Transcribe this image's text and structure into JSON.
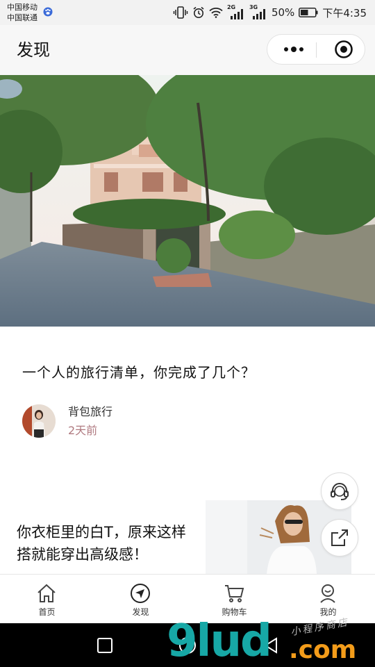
{
  "status_bar": {
    "carrier_1": "中国移动",
    "carrier_2": "中国联通",
    "net_label_1": "2G",
    "net_label_2": "3G",
    "battery": "50%",
    "time": "下午4:35"
  },
  "navbar": {
    "title": "发现",
    "capsule": {
      "more_icon": "more-dots-icon",
      "close_icon": "target-close-icon"
    }
  },
  "hero": {
    "image": "tree-lined street with old villa"
  },
  "article_1": {
    "title": "一个人的旅行清单，你完成了几个？",
    "author": "背包旅行",
    "time_ago": "2天前"
  },
  "article_2": {
    "title": "你衣柜里的白T，原来这样搭就能穿出高级感！"
  },
  "fabs": [
    {
      "icon": "customer-service-icon"
    },
    {
      "icon": "share-icon"
    }
  ],
  "tabs": [
    {
      "label": "首页",
      "icon": "home-icon"
    },
    {
      "label": "发现",
      "icon": "compass-icon"
    },
    {
      "label": "购物车",
      "icon": "cart-icon"
    },
    {
      "label": "我的",
      "icon": "user-icon"
    }
  ],
  "watermark": {
    "brand": "9lud",
    "domain": ".com",
    "script": "小程序商店"
  },
  "colors": {
    "time_ago": "#b07a80",
    "watermark_teal": "#17a8a6",
    "watermark_orange": "#f39c1a"
  }
}
